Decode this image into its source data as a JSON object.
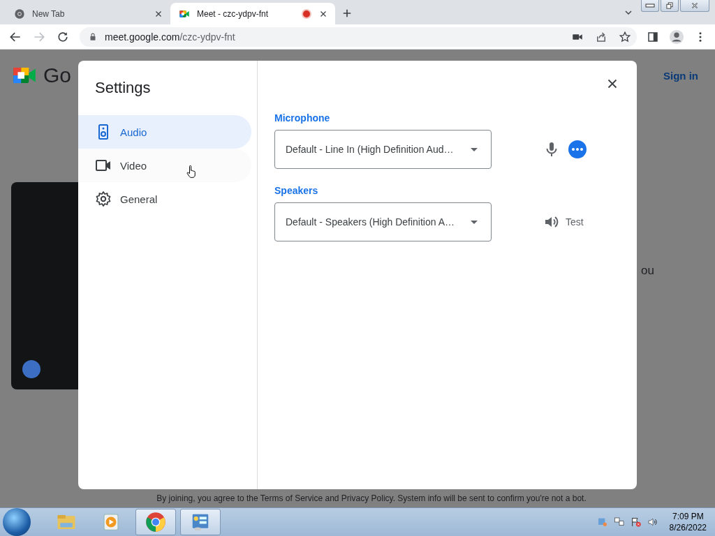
{
  "browser": {
    "tabs": [
      {
        "title": "New Tab",
        "kind": "chrome",
        "selected": false,
        "recording": false
      },
      {
        "title": "Meet - czc-ydpv-fnt",
        "kind": "meet",
        "selected": true,
        "recording": true
      }
    ],
    "address": {
      "host": "meet.google.com",
      "path": "/czc-ydpv-fnt"
    },
    "forward_disabled": true
  },
  "page": {
    "logo_text": "Go",
    "sign_in": "Sign in",
    "side_text": "ou",
    "footer": "By joining, you agree to the Terms of Service and Privacy Policy. System info will be sent to confirm you're not a bot."
  },
  "dialog": {
    "title": "Settings",
    "nav": [
      {
        "label": "Audio",
        "kind": "speaker",
        "selected": true,
        "hovered": false
      },
      {
        "label": "Video",
        "kind": "camera",
        "selected": false,
        "hovered": true
      },
      {
        "label": "General",
        "kind": "gear",
        "selected": false,
        "hovered": false
      }
    ],
    "sections": [
      {
        "label": "Microphone",
        "value": "Default - Line In (High Definition Aud…",
        "kind": "mic"
      },
      {
        "label": "Speakers",
        "value": "Default - Speakers (High Definition A…",
        "kind": "speaker",
        "action": "Test"
      }
    ]
  },
  "taskbar": {
    "apps": [
      {
        "kind": "folder",
        "active": false
      },
      {
        "kind": "media",
        "active": false
      },
      {
        "kind": "chrome",
        "active": true
      },
      {
        "kind": "panel",
        "active": true
      }
    ],
    "time": "7:09 PM",
    "date": "8/26/2022"
  }
}
